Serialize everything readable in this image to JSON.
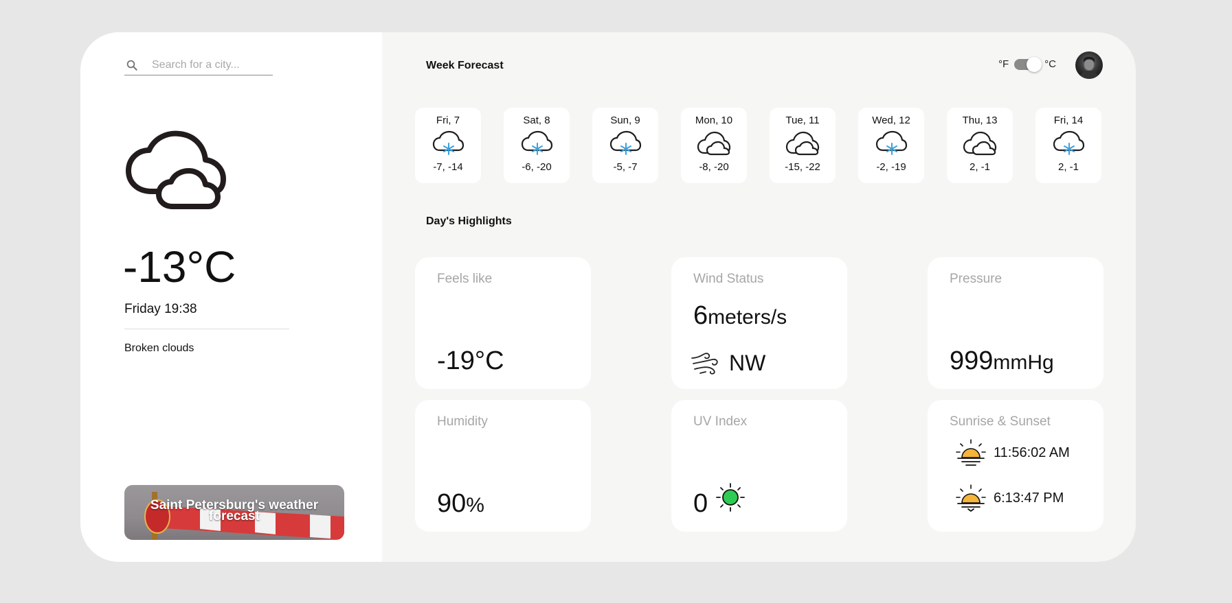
{
  "search": {
    "placeholder": "Search for a city..."
  },
  "current": {
    "temperature": "-13°C",
    "datetime": "Friday 19:38",
    "description": "Broken clouds",
    "icon": "broken-clouds-icon"
  },
  "city_banner": {
    "label": "Saint Petersburg's weather forecast"
  },
  "header": {
    "week_title": "Week Forecast",
    "highlights_title": "Day's Highlights",
    "unit_f": "°F",
    "unit_c": "°C",
    "selected_unit": "°C"
  },
  "forecast": [
    {
      "day": "Fri, 7",
      "range": "-7, -14",
      "icon": "snow-cloud-icon"
    },
    {
      "day": "Sat, 8",
      "range": "-6, -20",
      "icon": "snow-cloud-icon"
    },
    {
      "day": "Sun, 9",
      "range": "-5, -7",
      "icon": "snow-cloud-icon"
    },
    {
      "day": "Mon, 10",
      "range": "-8, -20",
      "icon": "cloud-icon"
    },
    {
      "day": "Tue, 11",
      "range": "-15, -22",
      "icon": "cloud-icon"
    },
    {
      "day": "Wed, 12",
      "range": "-2, -19",
      "icon": "snow-cloud-icon"
    },
    {
      "day": "Thu, 13",
      "range": "2, -1",
      "icon": "cloud-icon"
    },
    {
      "day": "Fri, 14",
      "range": "2, -1",
      "icon": "snow-cloud-icon"
    }
  ],
  "highlights": {
    "feels_like": {
      "label": "Feels like",
      "value": "-19°C"
    },
    "wind": {
      "label": "Wind Status",
      "value": "6",
      "unit": "meters/s",
      "direction": "NW"
    },
    "pressure": {
      "label": "Pressure",
      "value": "999",
      "unit": "mmHg"
    },
    "humidity": {
      "label": "Humidity",
      "value": "90",
      "unit": "%"
    },
    "uv": {
      "label": "UV Index",
      "value": "0",
      "color": "#2ecc52"
    },
    "sun": {
      "label": "Sunrise & Sunset",
      "sunrise": "11:56:02 AM",
      "sunset": "6:13:47 PM"
    }
  },
  "colors": {
    "snowflake": "#3aa0dd",
    "sun": "#f5b53b",
    "page_bg": "#e7e7e7",
    "panel_bg": "#f6f6f4"
  }
}
